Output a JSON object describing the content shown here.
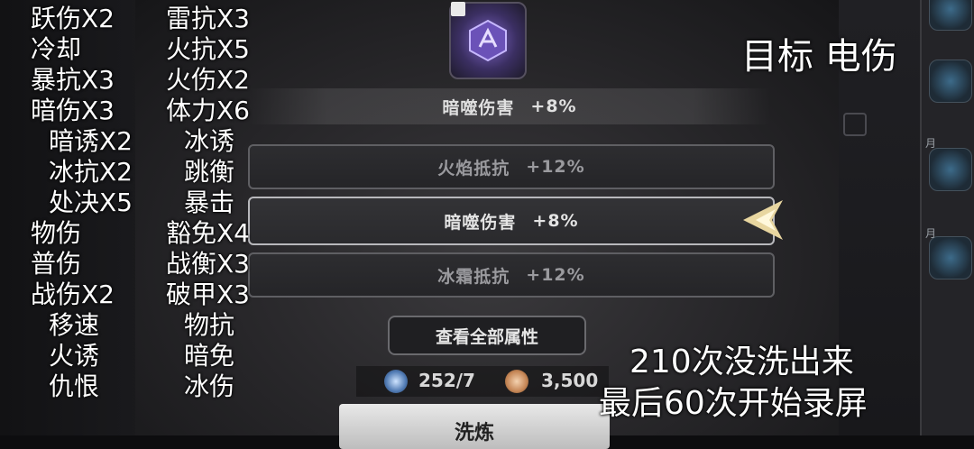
{
  "left_list_col1": [
    "跃伤X2",
    "冷却",
    "暴抗X3",
    "暗伤X3",
    "暗诱X2",
    "冰抗X2",
    "处决X5",
    "物伤",
    "普伤",
    "战伤X2",
    "移速",
    "火诱",
    "仇恨"
  ],
  "left_list_col2": [
    "雷抗X3",
    "火抗X5",
    "火伤X2",
    "体力X6",
    "冰诱",
    "跳衡",
    "暴击",
    "豁免X4",
    "战衡X3",
    "破甲X3",
    "物抗",
    "暗免",
    "冰伤"
  ],
  "target_text": "目标 电伤",
  "note_line1": "210次没洗出来",
  "note_line2": "最后60次开始录屏",
  "stats": [
    {
      "name": "暗噬伤害",
      "value": "+8%",
      "kind": "locked"
    },
    {
      "name": "火焰抵抗",
      "value": "+12%",
      "kind": "new"
    },
    {
      "name": "暗噬伤害",
      "value": "+8%",
      "kind": "new-selected"
    },
    {
      "name": "冰霜抵抗",
      "value": "+12%",
      "kind": "new"
    }
  ],
  "view_all_label": "查看全部属性",
  "wash_label": "洗炼",
  "currency": {
    "stone": "252/7",
    "coins": "3,500"
  },
  "side_tags": [
    "月",
    "月",
    "月",
    "月"
  ],
  "colors": {
    "item_purple": "#7f66c9",
    "arrow_gold": "#e8d6a0"
  }
}
